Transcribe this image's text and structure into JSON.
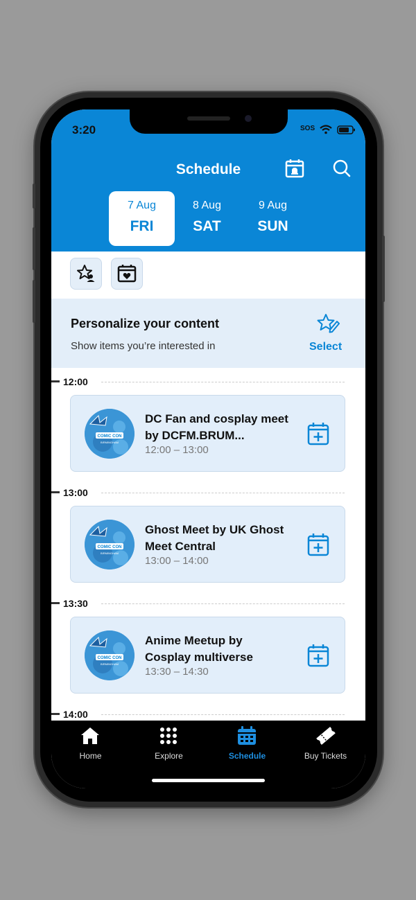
{
  "status_bar": {
    "time": "3:20",
    "sos": "SOS"
  },
  "header": {
    "title": "Schedule"
  },
  "days": [
    {
      "date": "7 Aug",
      "day": "FRI",
      "active": true
    },
    {
      "date": "8 Aug",
      "day": "SAT",
      "active": false
    },
    {
      "date": "9 Aug",
      "day": "SUN",
      "active": false
    }
  ],
  "personalize": {
    "title": "Personalize your content",
    "subtitle": "Show items you’re interested in",
    "action": "Select"
  },
  "timeline": [
    {
      "time": "12:00"
    },
    {
      "time": "13:00"
    },
    {
      "time": "13:30"
    },
    {
      "time": "14:00"
    }
  ],
  "events": [
    {
      "title": "DC Fan and cosplay meet by DCFM.BRUM...",
      "time": "12:00 – 13:00"
    },
    {
      "title": "Ghost Meet by UK Ghost Meet Central",
      "time": "13:00 – 14:00"
    },
    {
      "title": "Anime Meetup by Cosplay multiverse",
      "time": "13:30 – 14:30"
    }
  ],
  "logo_text": {
    "top": "COMIC CON",
    "bottom": "BIRMINGHAM"
  },
  "tabbar": [
    {
      "label": "Home",
      "icon": "home-icon",
      "active": false
    },
    {
      "label": "Explore",
      "icon": "grid-icon",
      "active": false
    },
    {
      "label": "Schedule",
      "icon": "calendar-icon",
      "active": true
    },
    {
      "label": "Buy Tickets",
      "icon": "ticket-icon",
      "active": false
    }
  ],
  "colors": {
    "accent": "#0a86d6",
    "card": "#e2eefa",
    "tabbar": "#000000"
  }
}
